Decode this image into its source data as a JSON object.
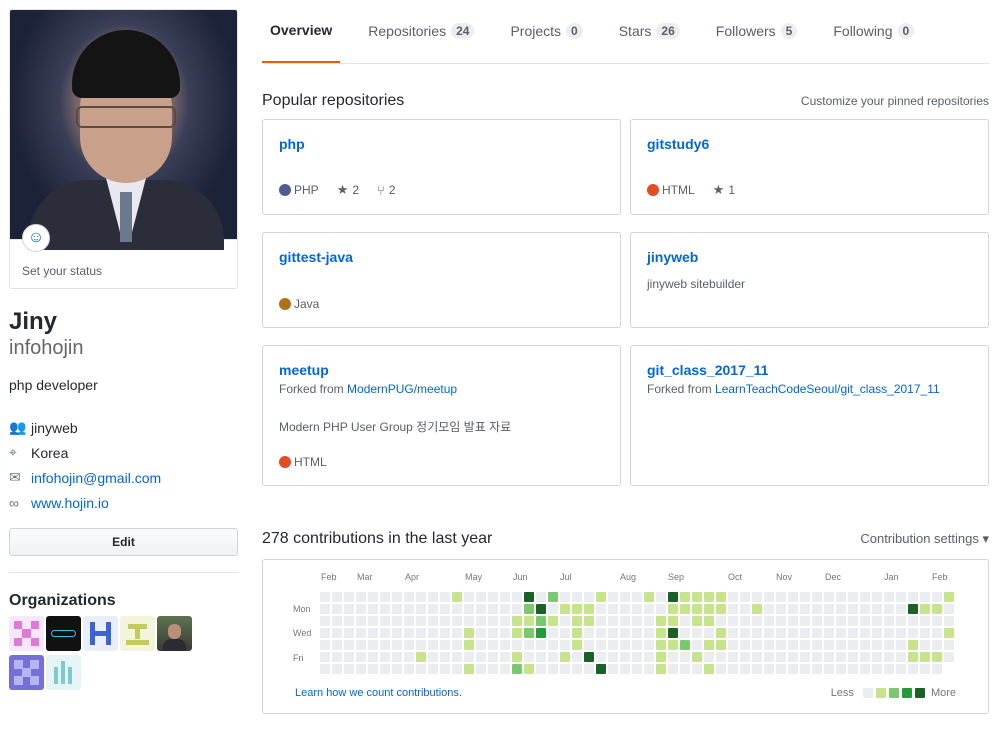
{
  "profile": {
    "full_name": "Jiny",
    "login": "infohojin",
    "status_text": "Set your status",
    "bio": "php developer",
    "details": [
      {
        "icon": "people-icon",
        "glyph": "👥",
        "text": "jinyweb",
        "link": false
      },
      {
        "icon": "location-icon",
        "glyph": "⌖",
        "text": "Korea",
        "link": false
      },
      {
        "icon": "mail-icon",
        "glyph": "✉",
        "text": "infohojin@gmail.com",
        "link": true
      },
      {
        "icon": "link-icon",
        "glyph": "∞",
        "text": "www.hojin.io",
        "link": true
      }
    ],
    "edit_label": "Edit",
    "organizations_title": "Organizations"
  },
  "tabs": [
    {
      "label": "Overview",
      "count": null,
      "active": true
    },
    {
      "label": "Repositories",
      "count": "24",
      "active": false
    },
    {
      "label": "Projects",
      "count": "0",
      "active": false
    },
    {
      "label": "Stars",
      "count": "26",
      "active": false
    },
    {
      "label": "Followers",
      "count": "5",
      "active": false
    },
    {
      "label": "Following",
      "count": "0",
      "active": false
    }
  ],
  "popular": {
    "title": "Popular repositories",
    "customize": "Customize your pinned repositories",
    "repos": [
      {
        "name": "php",
        "fork_from": "",
        "description": "",
        "language": "PHP",
        "lang_color": "#4F5D95",
        "stars": "2",
        "forks": "2"
      },
      {
        "name": "gitstudy6",
        "fork_from": "",
        "description": "",
        "language": "HTML",
        "lang_color": "#e34c26",
        "stars": "1",
        "forks": ""
      },
      {
        "name": "gittest-java",
        "fork_from": "",
        "description": "",
        "language": "Java",
        "lang_color": "#b07219",
        "stars": "",
        "forks": ""
      },
      {
        "name": "jinyweb",
        "fork_from": "",
        "description": "jinyweb sitebuilder",
        "language": "",
        "lang_color": "",
        "stars": "",
        "forks": ""
      },
      {
        "name": "meetup",
        "fork_prefix": "Forked from",
        "fork_from": "ModernPUG/meetup",
        "description": "Modern PHP User Group 정기모임 발표 자료",
        "language": "HTML",
        "lang_color": "#e34c26",
        "stars": "",
        "forks": ""
      },
      {
        "name": "git_class_2017_11",
        "fork_prefix": "Forked from",
        "fork_from": "LearnTeachCodeSeoul/git_class_2017_11",
        "description": "",
        "language": "",
        "lang_color": "",
        "stars": "",
        "forks": ""
      }
    ]
  },
  "contributions": {
    "title": "278 contributions in the last year",
    "settings": "Contribution settings ▾",
    "months": [
      "Feb",
      "Mar",
      "Apr",
      "May",
      "Jun",
      "Jul",
      "Aug",
      "Sep",
      "Oct",
      "Nov",
      "Dec",
      "Jan",
      "Feb"
    ],
    "days": [
      "Mon",
      "Wed",
      "Fri"
    ],
    "learn_link": "Learn how we count contributions.",
    "legend_less": "Less",
    "legend_more": "More",
    "colors": [
      "#ebedf0",
      "#c6e48b",
      "#7bc96f",
      "#239a3b",
      "#196127"
    ]
  }
}
